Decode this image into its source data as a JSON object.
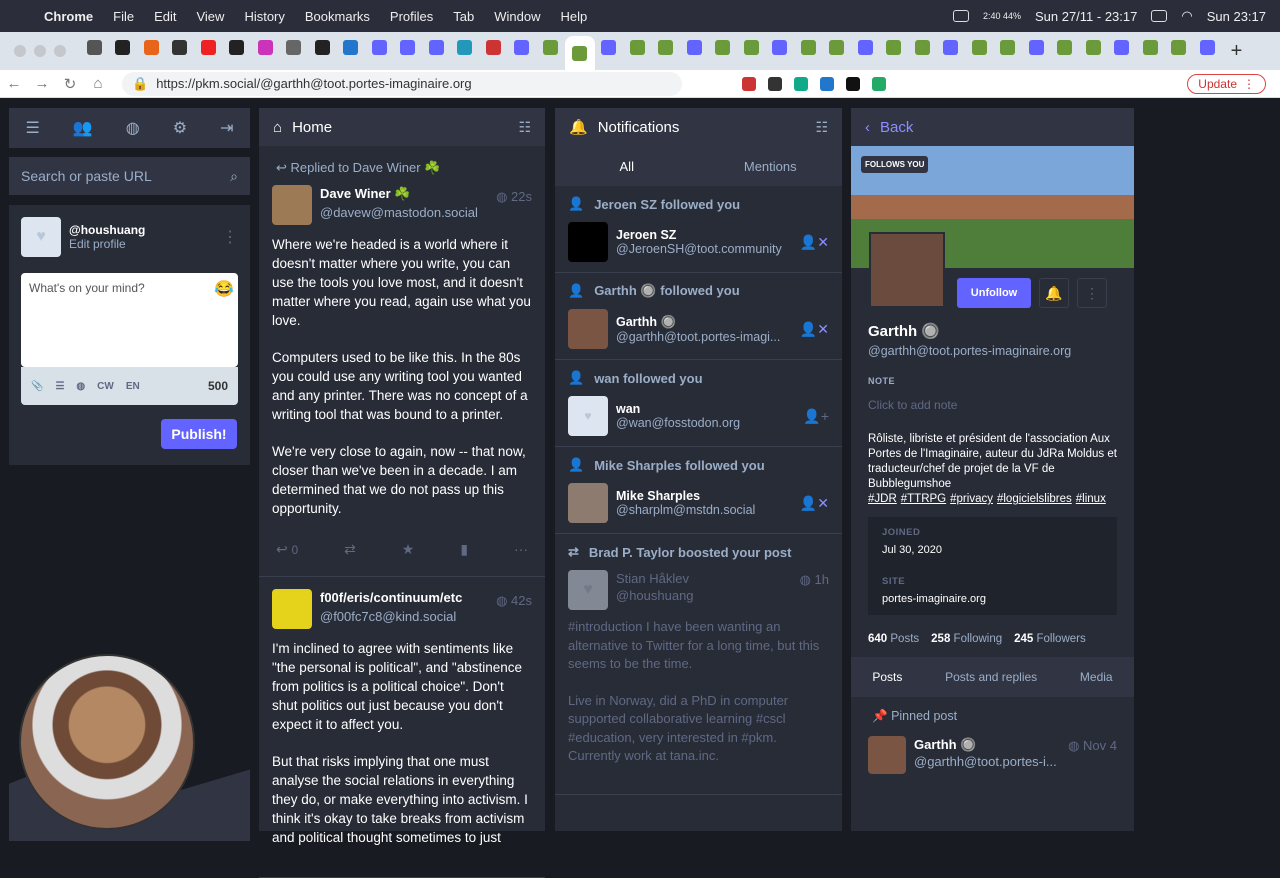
{
  "menubar": {
    "apple": "",
    "items": [
      "Chrome",
      "File",
      "Edit",
      "View",
      "History",
      "Bookmarks",
      "Profiles",
      "Tab",
      "Window",
      "Help"
    ],
    "battery": "2:40 44%",
    "datetime": "Sun 27/11 - 23:17",
    "clock": "Sun 23:17"
  },
  "browser": {
    "url": "https://pkm.social/@garthh@toot.portes-imaginaire.org",
    "update_label": "Update",
    "tab_count": 40
  },
  "sidebar": {
    "search_placeholder": "Search or paste URL",
    "username": "@houshuang",
    "edit_profile": "Edit profile",
    "compose_placeholder": "What's on your mind?",
    "cw": "CW",
    "lang": "EN",
    "char_count": "500",
    "publish": "Publish!"
  },
  "home": {
    "title": "Home",
    "statuses": [
      {
        "prepend": "Replied to Dave Winer ☘️",
        "name": "Dave Winer ☘️",
        "acct": "@davew@mastodon.social",
        "time": "22s",
        "paragraphs": [
          "Where we're headed is a world where it doesn't matter where you write, you can use the tools you love most, and it doesn't matter where you read, again use what you love.",
          "Computers used to be like this. In the 80s you could use any writing tool you wanted and any printer. There was no concept of a writing tool that was bound to a printer.",
          "We're very close to again, now -- that now, closer than we've been in a decade. I am determined that we do not pass up this opportunity."
        ],
        "replies": "0"
      },
      {
        "name": "f00f/eris/continuum/etc",
        "acct": "@f00fc7c8@kind.social",
        "time": "42s",
        "paragraphs": [
          "I'm inclined to agree with sentiments like \"the personal is political\", and \"abstinence from politics is a political choice\". Don't shut politics out just because you don't expect it to affect you.",
          "But that risks implying that one must analyse the social relations in everything they do, or make everything into activism. I think it's okay to take breaks from activism and political thought sometimes to just"
        ]
      }
    ]
  },
  "notifications": {
    "title": "Notifications",
    "tabs": [
      "All",
      "Mentions"
    ],
    "items": [
      {
        "title": "Jeroen SZ followed you",
        "name": "Jeroen SZ",
        "acct": "@JeroenSH@toot.community"
      },
      {
        "title": "Garthh 🔘 followed you",
        "name": "Garthh 🔘",
        "acct": "@garthh@toot.portes-imagi..."
      },
      {
        "title": "wan followed you",
        "name": "wan",
        "acct": "@wan@fosstodon.org"
      },
      {
        "title": "Mike Sharples followed you",
        "name": "Mike Sharples",
        "acct": "@sharplm@mstdn.social"
      }
    ],
    "boost": {
      "title": "Brad P. Taylor boosted your post",
      "name": "Stian Håklev",
      "acct": "@houshuang",
      "time": "1h",
      "paragraphs": [
        "#introduction  I have been wanting an alternative to Twitter for a long time, but this seems to be the time.",
        "Live in Norway, did a PhD in computer supported collaborative learning #cscl #education, very interested in #pkm. Currently work at tana.inc."
      ]
    }
  },
  "profile": {
    "back": "Back",
    "follows_you": "FOLLOWS YOU",
    "unfollow": "Unfollow",
    "name": "Garthh 🔘",
    "acct": "@garthh@toot.portes-imaginaire.org",
    "note_label": "NOTE",
    "note_placeholder": "Click to add note",
    "bio": "Rôliste, libriste et président de l'association Aux Portes de l'Imaginaire, auteur du JdRa Moldus et traducteur/chef de projet de la VF de Bubblegumshoe",
    "tags": [
      "#JDR",
      "#TTRPG",
      "#privacy",
      "#logicielslibres",
      "#linux"
    ],
    "joined_label": "JOINED",
    "joined": "Jul 30, 2020",
    "site_label": "SITE",
    "site": "portes-imaginaire.org",
    "posts": "640",
    "posts_label": "Posts",
    "following": "258",
    "following_label": "Following",
    "followers": "245",
    "followers_label": "Followers",
    "tabs": [
      "Posts",
      "Posts and replies",
      "Media"
    ],
    "pinned": "Pinned post",
    "pinned_name": "Garthh 🔘",
    "pinned_acct": "@garthh@toot.portes-i...",
    "pinned_time": "Nov 4"
  },
  "colors": {
    "accent": "#6364ff",
    "panel": "#282c37",
    "bg": "#191b22"
  }
}
